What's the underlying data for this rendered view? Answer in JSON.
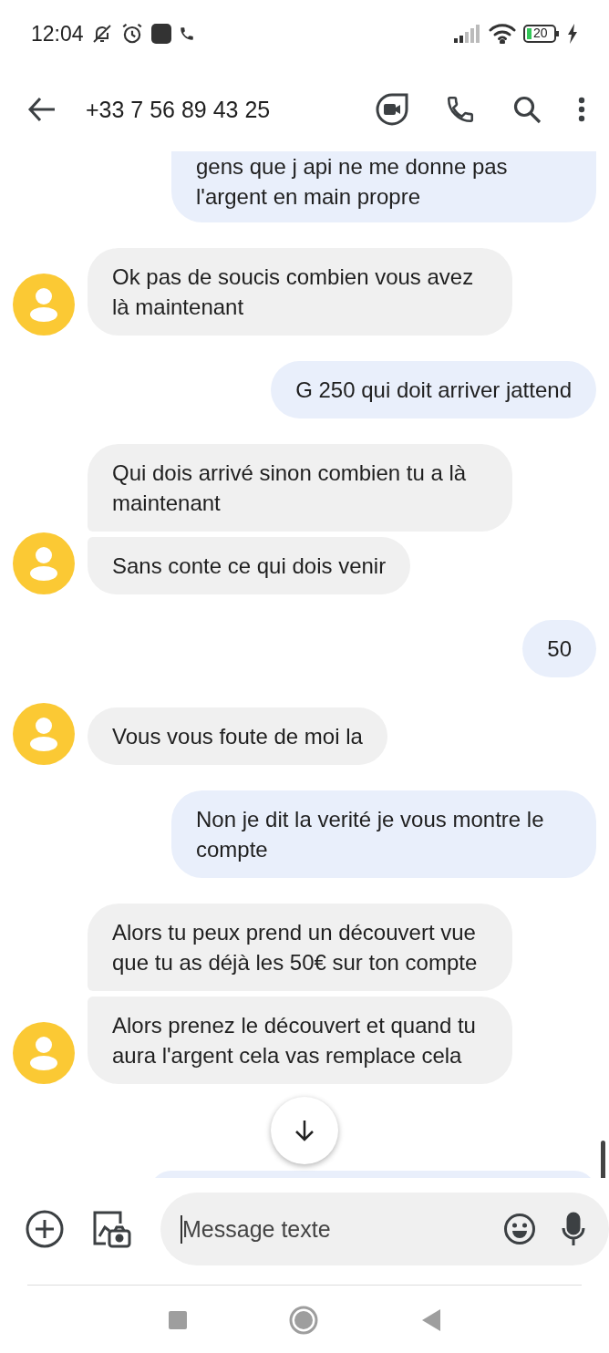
{
  "status_bar": {
    "time": "12:04",
    "battery": "20"
  },
  "header": {
    "title": "+33 7 56 89 43 25"
  },
  "groups": [
    {
      "kind": "outgoing",
      "bubbles": [
        "gens que j api ne me donne pas l'argent en main propre"
      ]
    },
    {
      "kind": "incoming",
      "bubbles": [
        "Ok pas de soucis combien vous avez là maintenant"
      ]
    },
    {
      "kind": "outgoing",
      "bubbles": [
        "G 250 qui doit arriver jattend"
      ]
    },
    {
      "kind": "incoming",
      "bubbles": [
        "Qui dois arrivé sinon combien tu a là maintenant",
        "Sans conte ce qui dois venir"
      ]
    },
    {
      "kind": "outgoing",
      "bubbles": [
        "50"
      ]
    },
    {
      "kind": "incoming",
      "bubbles": [
        "Vous vous foute de moi la"
      ]
    },
    {
      "kind": "outgoing",
      "bubbles": [
        "Non je dit la verité je vous montre le compte"
      ]
    },
    {
      "kind": "incoming",
      "bubbles": [
        "Alors tu peux prend un découvert vue que tu as déjà les 50€ sur ton compte",
        "Alors prenez le découvert et quand tu aura l'argent cela vas remplace cela"
      ]
    }
  ],
  "composer": {
    "placeholder": "Message texte"
  }
}
